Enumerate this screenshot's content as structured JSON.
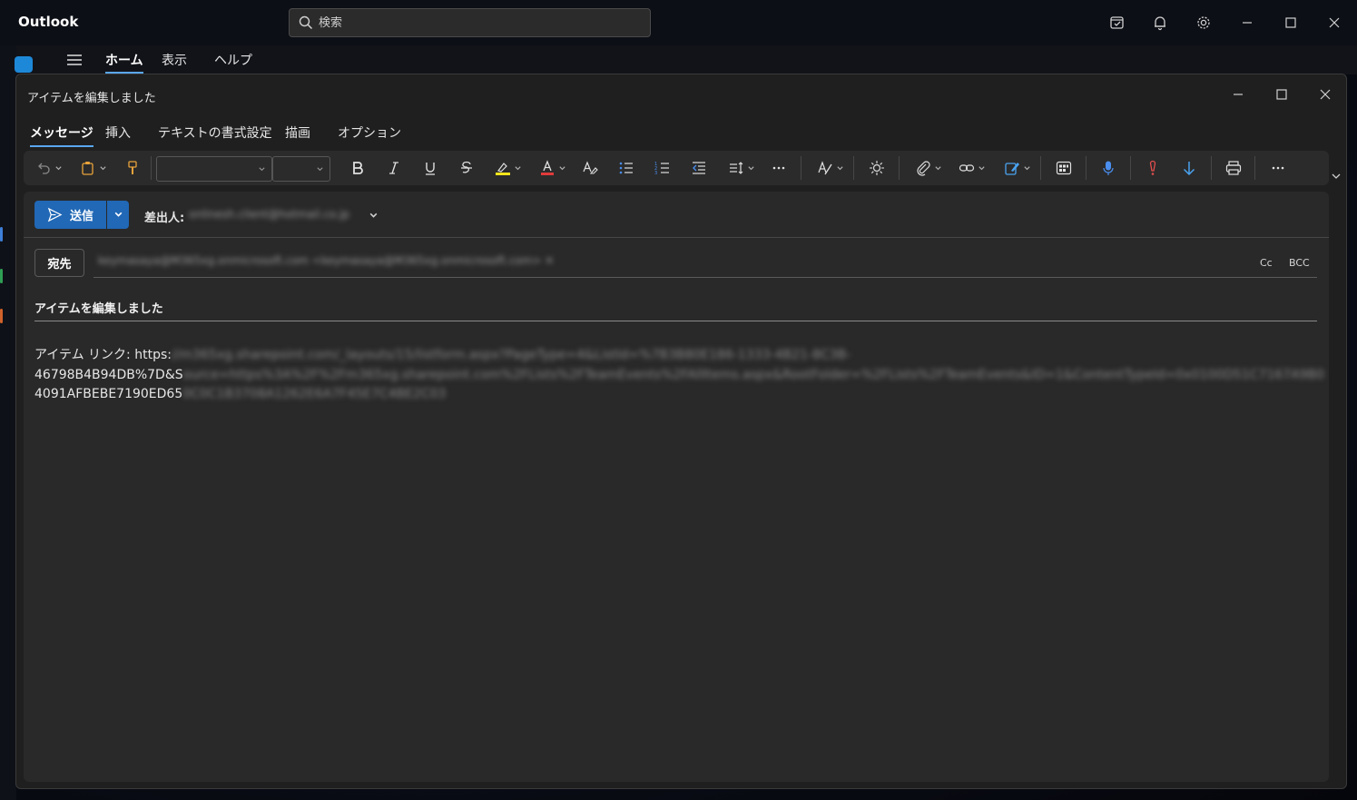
{
  "app": {
    "title": "Outlook",
    "search_placeholder": "検索"
  },
  "nav": {
    "tabs": [
      "ホーム",
      "表示",
      "ヘルプ"
    ],
    "active_tab": "ホーム"
  },
  "compose": {
    "window_title": "アイテムを編集しました",
    "ribbon_tabs": [
      "メッセージ",
      "挿入",
      "テキストの書式設定",
      "描画",
      "オプション"
    ],
    "active_ribbon_tab": "メッセージ",
    "font_name": "",
    "font_size": "",
    "send_label": "送信",
    "from_label": "差出人:",
    "from_value": "onlinesh.client@hotmail.co.jp",
    "to_label": "宛先",
    "to_value": "keymasaya@M365xg.onmicrosoft.com <keymasaya@M365xg.onmicrosoft.com>  ✕",
    "cc_label": "Cc",
    "bcc_label": "BCC",
    "subject": "アイテムを編集しました",
    "body": {
      "line1_visible": "アイテム リンク: https:",
      "line1_blurred": "//m365xg.sharepoint.com/_layouts/15/listform.aspx?PageType=4&ListId=%7B3B80E186-1333-4B21-8C3B-",
      "line2_visible": "46798B4B94DB%7D&S",
      "line2_blurred": "ource=https%3A%2F%2Fm365xg.sharepoint.com%2FLists%2FTeamEvents%2FAllItems.aspx&RootFolder=%2FLists%2FTeamEvents&ID=1&ContentTypeId=0x0100D51C7167A9B0",
      "line3_visible": "4091AFBEBE7190ED65",
      "line3_blurred": "0C0C1B3708A1262E6A7F45E7C4BE2C03"
    }
  },
  "colors": {
    "accent": "#2168b6",
    "tab_underline": "#5aa7f0",
    "highlight_yellow": "#f5e51b",
    "font_red": "#e03a3a",
    "importance_red": "#e24e4e",
    "low_importance_blue": "#4aa3f0",
    "dictate_blue": "#4a8ef0"
  },
  "icons": {
    "toolbar": [
      "undo-icon",
      "clipboard-icon",
      "format-painter-icon",
      "bold-icon",
      "italic-icon",
      "underline-icon",
      "strikethrough-icon",
      "highlight-icon",
      "font-color-icon",
      "clear-format-icon",
      "bullets-icon",
      "numbering-icon",
      "outdent-icon",
      "line-spacing-icon",
      "more-format-icon",
      "editor-icon",
      "immersive-reader-icon",
      "attach-icon",
      "link-icon",
      "signature-icon",
      "apps-icon",
      "dictate-icon",
      "high-importance-icon",
      "low-importance-icon",
      "print-icon",
      "more-icon"
    ]
  }
}
